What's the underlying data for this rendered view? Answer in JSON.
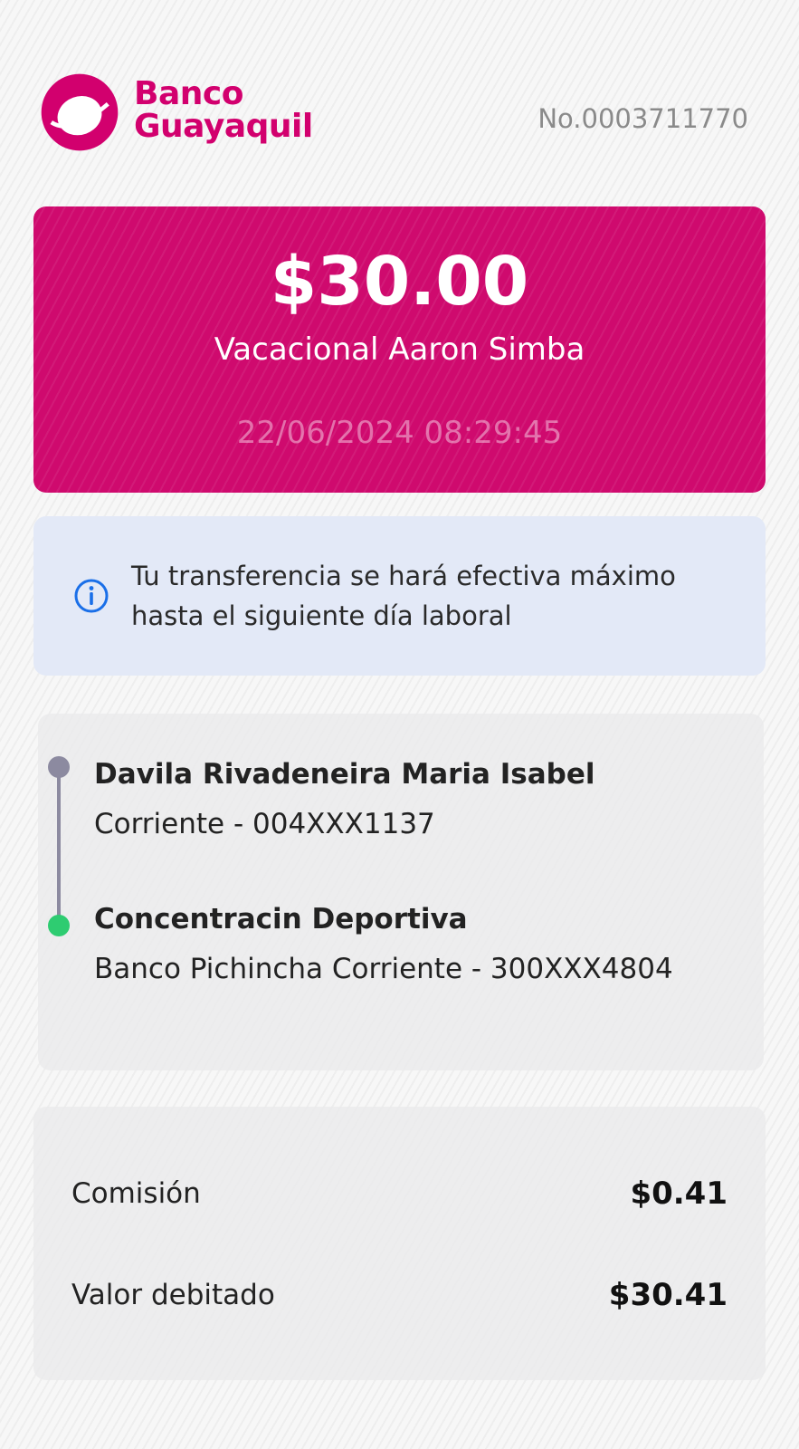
{
  "header": {
    "logo_line1": "Banco",
    "logo_line2": "Guayaquil",
    "receipt_number": "No.0003711770"
  },
  "transfer": {
    "amount": "$30.00",
    "beneficiary": "Vacacional Aaron Simba",
    "datetime": "22/06/2024 08:29:45"
  },
  "notice": {
    "text": "Tu transferencia se hará efectiva máximo hasta el siguiente día laboral",
    "icon": "info-circle-icon"
  },
  "origin": {
    "name": "Davila Rivadeneira Maria Isabel",
    "account": "Corriente - 004XXX1137"
  },
  "destination": {
    "name": "Concentracin Deportiva",
    "account": "Banco Pichincha Corriente - 300XXX4804"
  },
  "summary": {
    "commission_label": "Comisión",
    "commission_value": "$0.41",
    "debited_label": "Valor debitado",
    "debited_value": "$30.41"
  },
  "colors": {
    "brand": "#d2006e",
    "card": "#cf0a6e",
    "info_bg": "#e3e9f7",
    "origin_dot": "#8c8aa0",
    "destination_dot": "#2ecc71"
  }
}
